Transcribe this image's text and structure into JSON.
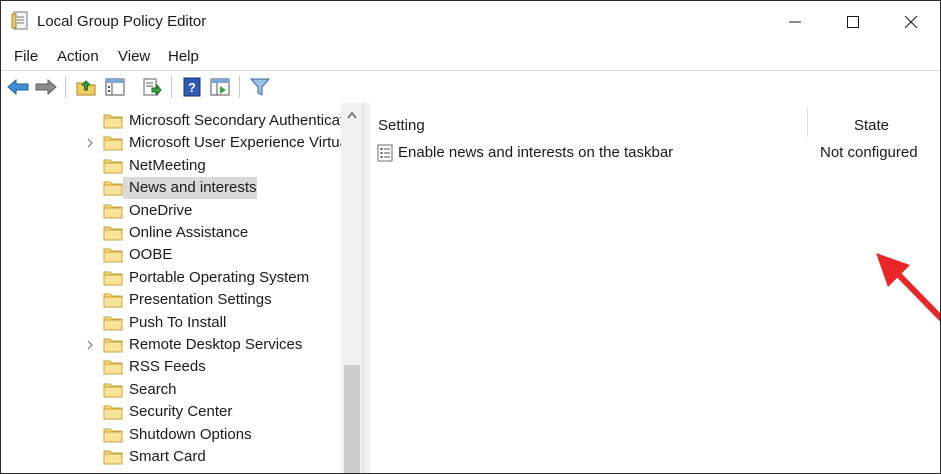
{
  "window": {
    "title": "Local Group Policy Editor"
  },
  "menu": [
    "File",
    "Action",
    "View",
    "Help"
  ],
  "tree": {
    "items": [
      {
        "label": "Microsoft Secondary Authenticat",
        "expandable": false
      },
      {
        "label": "Microsoft User Experience Virtua",
        "expandable": true
      },
      {
        "label": "NetMeeting",
        "expandable": false
      },
      {
        "label": "News and interests",
        "expandable": false,
        "selected": true
      },
      {
        "label": "OneDrive",
        "expandable": false
      },
      {
        "label": "Online Assistance",
        "expandable": false
      },
      {
        "label": "OOBE",
        "expandable": false
      },
      {
        "label": "Portable Operating System",
        "expandable": false
      },
      {
        "label": "Presentation Settings",
        "expandable": false
      },
      {
        "label": "Push To Install",
        "expandable": false
      },
      {
        "label": "Remote Desktop Services",
        "expandable": true
      },
      {
        "label": "RSS Feeds",
        "expandable": false
      },
      {
        "label": "Search",
        "expandable": false
      },
      {
        "label": "Security Center",
        "expandable": false
      },
      {
        "label": "Shutdown Options",
        "expandable": false
      },
      {
        "label": "Smart Card",
        "expandable": false
      }
    ]
  },
  "details": {
    "columns": {
      "setting": "Setting",
      "state": "State"
    },
    "rows": [
      {
        "setting": "Enable news and interests on the taskbar",
        "state": "Not configured"
      }
    ]
  },
  "colors": {
    "folder": "#f6d97a",
    "arrow": "#e8262a",
    "selection": "#d9d9d9"
  },
  "icons": {
    "toolbar": [
      "back-arrow-icon",
      "forward-arrow-icon",
      "up-folder-icon",
      "show-hide-tree-icon",
      "export-list-icon",
      "help-icon",
      "properties-icon",
      "filter-icon"
    ]
  }
}
